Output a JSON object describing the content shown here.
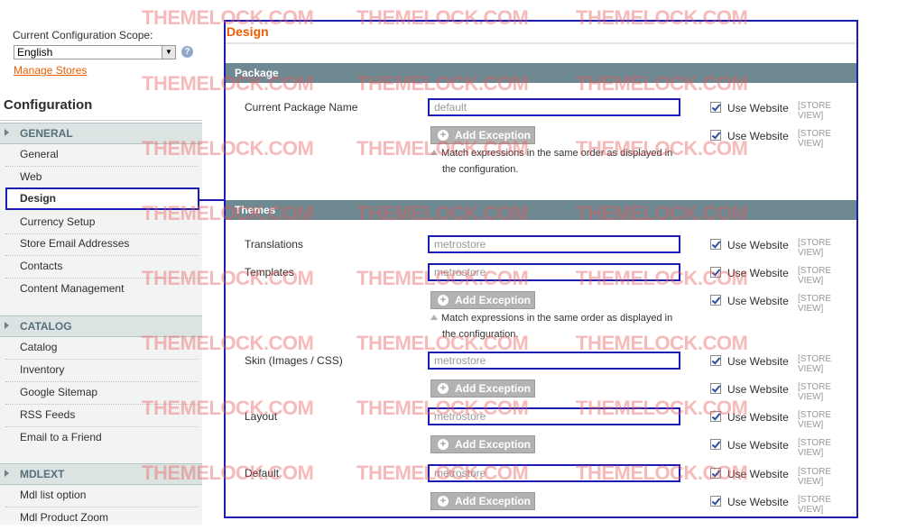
{
  "scope": {
    "label": "Current Configuration Scope:",
    "value": "English",
    "help": "?",
    "manage_link": "Manage Stores"
  },
  "sidebar": {
    "title": "Configuration",
    "groups": [
      {
        "label": "GENERAL",
        "items": [
          "General",
          "Web",
          "Design",
          "Currency Setup",
          "Store Email Addresses",
          "Contacts",
          "Content Management"
        ]
      },
      {
        "label": "CATALOG",
        "items": [
          "Catalog",
          "Inventory",
          "Google Sitemap",
          "RSS Feeds",
          "Email to a Friend"
        ]
      },
      {
        "label": "MDLEXT",
        "items": [
          "Mdl list option",
          "Mdl Product Zoom"
        ]
      }
    ],
    "active_item": "Design"
  },
  "main": {
    "title": "Design",
    "package": {
      "header": "Package",
      "current_package_label": "Current Package Name",
      "current_package_value": "default"
    },
    "themes": {
      "header": "Themes",
      "translations_label": "Translations",
      "translations_value": "metrostore",
      "templates_label": "Templates",
      "templates_value": "metrostore",
      "skin_label": "Skin (Images / CSS)",
      "skin_value": "metrostore",
      "layout_label": "Layout",
      "layout_value": "metrostore",
      "default_label": "Default",
      "default_value": "metrostore"
    },
    "add_exception": "Add Exception",
    "note_line1": "Match expressions in the same order as displayed in",
    "note_line2": "the configuration.",
    "use_website": "Use Website",
    "store_view": "[STORE VIEW]"
  },
  "watermark": "THEMELOCK.COM",
  "colors": {
    "accent": "#eb5e00",
    "highlight": "#1c1cb5",
    "section_header": "#6f8992",
    "group_header": "#dce3e3"
  }
}
